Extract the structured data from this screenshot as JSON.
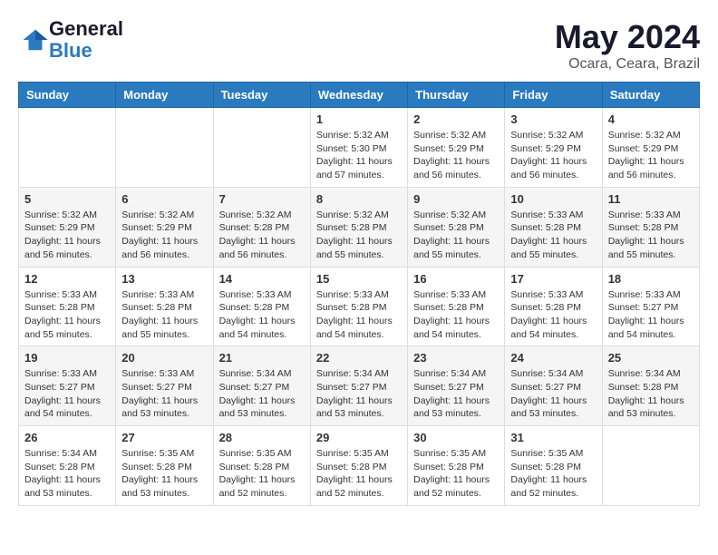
{
  "logo": {
    "line1": "General",
    "line2": "Blue"
  },
  "header": {
    "month": "May 2024",
    "location": "Ocara, Ceara, Brazil"
  },
  "weekdays": [
    "Sunday",
    "Monday",
    "Tuesday",
    "Wednesday",
    "Thursday",
    "Friday",
    "Saturday"
  ],
  "weeks": [
    [
      {
        "day": "",
        "info": ""
      },
      {
        "day": "",
        "info": ""
      },
      {
        "day": "",
        "info": ""
      },
      {
        "day": "1",
        "info": "Sunrise: 5:32 AM\nSunset: 5:30 PM\nDaylight: 11 hours\nand 57 minutes."
      },
      {
        "day": "2",
        "info": "Sunrise: 5:32 AM\nSunset: 5:29 PM\nDaylight: 11 hours\nand 56 minutes."
      },
      {
        "day": "3",
        "info": "Sunrise: 5:32 AM\nSunset: 5:29 PM\nDaylight: 11 hours\nand 56 minutes."
      },
      {
        "day": "4",
        "info": "Sunrise: 5:32 AM\nSunset: 5:29 PM\nDaylight: 11 hours\nand 56 minutes."
      }
    ],
    [
      {
        "day": "5",
        "info": "Sunrise: 5:32 AM\nSunset: 5:29 PM\nDaylight: 11 hours\nand 56 minutes."
      },
      {
        "day": "6",
        "info": "Sunrise: 5:32 AM\nSunset: 5:29 PM\nDaylight: 11 hours\nand 56 minutes."
      },
      {
        "day": "7",
        "info": "Sunrise: 5:32 AM\nSunset: 5:28 PM\nDaylight: 11 hours\nand 56 minutes."
      },
      {
        "day": "8",
        "info": "Sunrise: 5:32 AM\nSunset: 5:28 PM\nDaylight: 11 hours\nand 55 minutes."
      },
      {
        "day": "9",
        "info": "Sunrise: 5:32 AM\nSunset: 5:28 PM\nDaylight: 11 hours\nand 55 minutes."
      },
      {
        "day": "10",
        "info": "Sunrise: 5:33 AM\nSunset: 5:28 PM\nDaylight: 11 hours\nand 55 minutes."
      },
      {
        "day": "11",
        "info": "Sunrise: 5:33 AM\nSunset: 5:28 PM\nDaylight: 11 hours\nand 55 minutes."
      }
    ],
    [
      {
        "day": "12",
        "info": "Sunrise: 5:33 AM\nSunset: 5:28 PM\nDaylight: 11 hours\nand 55 minutes."
      },
      {
        "day": "13",
        "info": "Sunrise: 5:33 AM\nSunset: 5:28 PM\nDaylight: 11 hours\nand 55 minutes."
      },
      {
        "day": "14",
        "info": "Sunrise: 5:33 AM\nSunset: 5:28 PM\nDaylight: 11 hours\nand 54 minutes."
      },
      {
        "day": "15",
        "info": "Sunrise: 5:33 AM\nSunset: 5:28 PM\nDaylight: 11 hours\nand 54 minutes."
      },
      {
        "day": "16",
        "info": "Sunrise: 5:33 AM\nSunset: 5:28 PM\nDaylight: 11 hours\nand 54 minutes."
      },
      {
        "day": "17",
        "info": "Sunrise: 5:33 AM\nSunset: 5:28 PM\nDaylight: 11 hours\nand 54 minutes."
      },
      {
        "day": "18",
        "info": "Sunrise: 5:33 AM\nSunset: 5:27 PM\nDaylight: 11 hours\nand 54 minutes."
      }
    ],
    [
      {
        "day": "19",
        "info": "Sunrise: 5:33 AM\nSunset: 5:27 PM\nDaylight: 11 hours\nand 54 minutes."
      },
      {
        "day": "20",
        "info": "Sunrise: 5:33 AM\nSunset: 5:27 PM\nDaylight: 11 hours\nand 53 minutes."
      },
      {
        "day": "21",
        "info": "Sunrise: 5:34 AM\nSunset: 5:27 PM\nDaylight: 11 hours\nand 53 minutes."
      },
      {
        "day": "22",
        "info": "Sunrise: 5:34 AM\nSunset: 5:27 PM\nDaylight: 11 hours\nand 53 minutes."
      },
      {
        "day": "23",
        "info": "Sunrise: 5:34 AM\nSunset: 5:27 PM\nDaylight: 11 hours\nand 53 minutes."
      },
      {
        "day": "24",
        "info": "Sunrise: 5:34 AM\nSunset: 5:27 PM\nDaylight: 11 hours\nand 53 minutes."
      },
      {
        "day": "25",
        "info": "Sunrise: 5:34 AM\nSunset: 5:28 PM\nDaylight: 11 hours\nand 53 minutes."
      }
    ],
    [
      {
        "day": "26",
        "info": "Sunrise: 5:34 AM\nSunset: 5:28 PM\nDaylight: 11 hours\nand 53 minutes."
      },
      {
        "day": "27",
        "info": "Sunrise: 5:35 AM\nSunset: 5:28 PM\nDaylight: 11 hours\nand 53 minutes."
      },
      {
        "day": "28",
        "info": "Sunrise: 5:35 AM\nSunset: 5:28 PM\nDaylight: 11 hours\nand 52 minutes."
      },
      {
        "day": "29",
        "info": "Sunrise: 5:35 AM\nSunset: 5:28 PM\nDaylight: 11 hours\nand 52 minutes."
      },
      {
        "day": "30",
        "info": "Sunrise: 5:35 AM\nSunset: 5:28 PM\nDaylight: 11 hours\nand 52 minutes."
      },
      {
        "day": "31",
        "info": "Sunrise: 5:35 AM\nSunset: 5:28 PM\nDaylight: 11 hours\nand 52 minutes."
      },
      {
        "day": "",
        "info": ""
      }
    ]
  ]
}
